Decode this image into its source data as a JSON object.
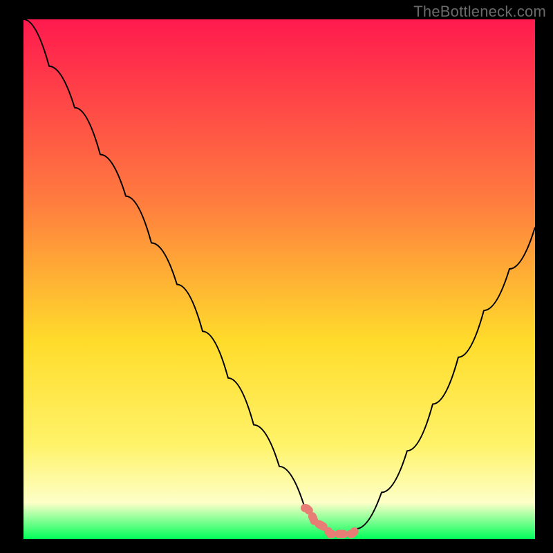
{
  "watermark": "TheBottleneck.com",
  "colors": {
    "black": "#000000",
    "curve": "#000000",
    "highlight": "#e77d75",
    "grad_top": "#ff1a4e",
    "grad_mid1": "#ff7c3f",
    "grad_mid2": "#ffdc2b",
    "grad_mid3": "#fff36a",
    "grad_mid4": "#fdffc8",
    "grad_bottom": "#00ff5a"
  },
  "chart_data": {
    "type": "line",
    "title": "",
    "xlabel": "",
    "ylabel": "",
    "xlim": [
      0,
      100
    ],
    "ylim": [
      0,
      100
    ],
    "x": [
      0,
      5,
      10,
      15,
      20,
      25,
      30,
      35,
      40,
      45,
      50,
      55,
      57,
      60,
      63,
      64,
      65,
      70,
      75,
      80,
      85,
      90,
      95,
      100
    ],
    "y": [
      100,
      91,
      83,
      74,
      66,
      57,
      49,
      40,
      31,
      22,
      14,
      6,
      3,
      1,
      1,
      1,
      2,
      9,
      17,
      26,
      35,
      44,
      52,
      60
    ],
    "highlight_range_x": [
      55,
      65
    ],
    "note": "Bottleneck-style V-curve. Y is relative bottleneck percentage (0=no bottleneck, 100=max). X is a component balance parameter (normalized 0–100). Values estimated from pixel positions; chart has no numeric axis labels."
  }
}
